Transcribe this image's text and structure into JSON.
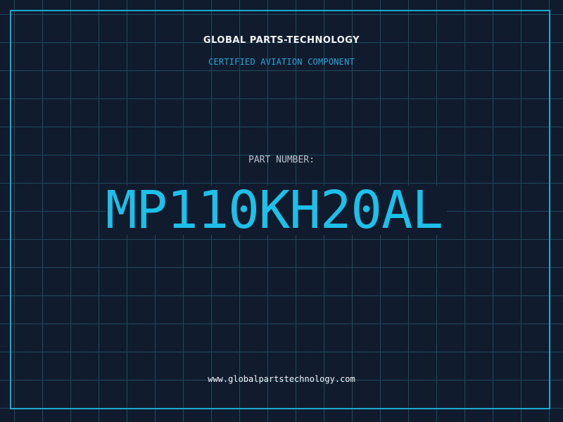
{
  "card": {
    "company": "GLOBAL PARTS-TECHNOLOGY",
    "subtitle": "CERTIFIED AVIATION COMPONENT",
    "part_label": "PART NUMBER:",
    "part_number": "MP110KH20AL",
    "website": "www.globalpartstechnology.com"
  },
  "colors": {
    "background": "#111b2e",
    "grid": "#1f4a5e",
    "accent": "#1ec0ea",
    "text": "#f2f4f6"
  }
}
